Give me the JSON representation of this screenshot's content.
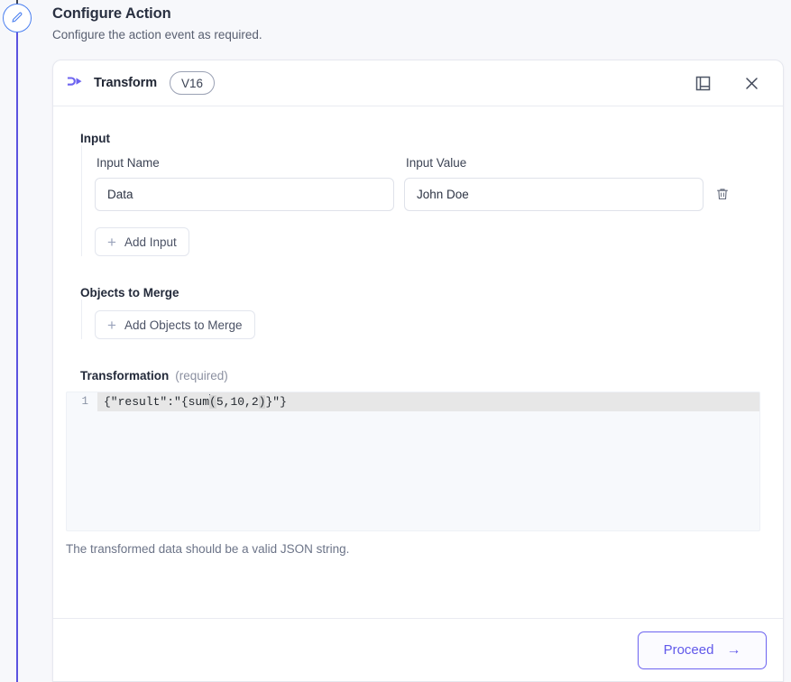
{
  "page": {
    "title": "Configure Action",
    "subtitle": "Configure the action event as required."
  },
  "rail": {
    "step_icon": "pencil-icon",
    "line_color_active": "#5b53e0"
  },
  "card": {
    "header": {
      "icon": "transform-icon",
      "title": "Transform",
      "version_badge": "V16",
      "actions": [
        {
          "name": "docs-panel-icon",
          "label": "Documentation"
        },
        {
          "name": "close-icon",
          "label": "Close"
        }
      ]
    },
    "input_section": {
      "label": "Input",
      "columns": {
        "name": "Input Name",
        "value": "Input Value"
      },
      "rows": [
        {
          "name_value": "Data",
          "name_placeholder": "Input Name",
          "value_value": "John Doe",
          "value_placeholder": "Input Value",
          "delete_icon": "trash-icon"
        }
      ],
      "add_button": "Add Input"
    },
    "objects_section": {
      "label": "Objects to Merge",
      "add_button": "Add Objects to Merge"
    },
    "transformation_section": {
      "label": "Transformation",
      "required_hint": "(required)",
      "editor": {
        "line_number": "1",
        "code_before": "{\"result\":\"{sum",
        "code_open_paren": "(",
        "code_args": "5,10,2",
        "code_close_paren": ")",
        "code_after": "}\"}",
        "full_code": "{\"result\":\"{sum(5,10,2)}\"}"
      },
      "helper_text": "The transformed data should be a valid JSON string."
    },
    "footer": {
      "proceed_label": "Proceed",
      "proceed_arrow": "→"
    }
  },
  "colors": {
    "accent_purple": "#6c63f0",
    "rail_blue": "#4a7ff0",
    "transform_icon": "#6c63f0",
    "text_dark": "#232a3a",
    "text_muted": "#6c7488"
  }
}
